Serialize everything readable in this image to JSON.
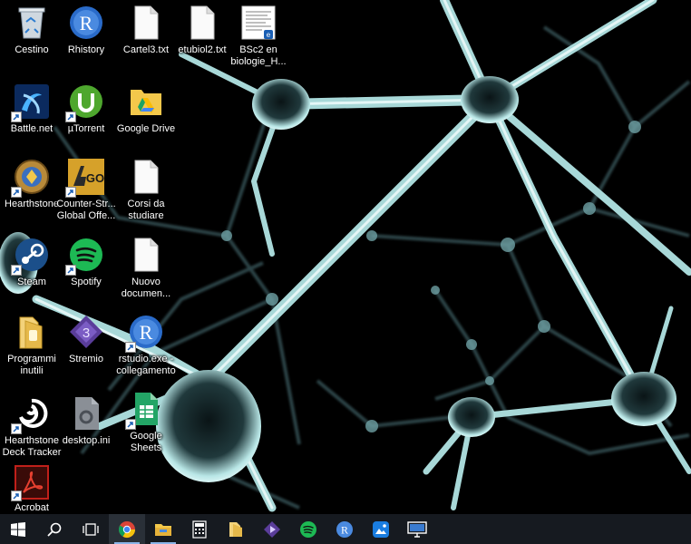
{
  "desktop": {
    "icons": [
      {
        "label": "Cestino",
        "icon": "recycle-bin-icon"
      },
      {
        "label": "Rhistory",
        "icon": "r-logo-icon"
      },
      {
        "label": "Cartel3.txt",
        "icon": "text-file-icon"
      },
      {
        "label": "etubiol2.txt",
        "icon": "text-file-icon"
      },
      {
        "label": "BSc2 en biologie_H...",
        "icon": "document-thumbnail-icon"
      },
      {
        "label": "Battle.net",
        "icon": "battle-net-icon"
      },
      {
        "label": "µTorrent",
        "icon": "utorrent-icon"
      },
      {
        "label": "Google Drive",
        "icon": "google-drive-folder-icon"
      },
      {
        "label": "Hearthstone",
        "icon": "hearthstone-icon"
      },
      {
        "label": "Counter-Str... Global Offe...",
        "icon": "csgo-icon",
        "badge": "GO"
      },
      {
        "label": "Corsi da studiare",
        "icon": "blank-file-icon"
      },
      {
        "label": "Steam",
        "icon": "steam-icon"
      },
      {
        "label": "Spotify",
        "icon": "spotify-icon"
      },
      {
        "label": "Nuovo documen...",
        "icon": "blank-file-icon"
      },
      {
        "label": "Programmi inutili",
        "icon": "folder-icon"
      },
      {
        "label": "Stremio",
        "icon": "stremio-icon",
        "badge": "3"
      },
      {
        "label": "rstudio.exe - collegamento",
        "icon": "r-logo-icon"
      },
      {
        "label": "Hearthstone Deck Tracker",
        "icon": "deck-tracker-icon"
      },
      {
        "label": "desktop.ini",
        "icon": "settings-file-icon"
      },
      {
        "label": "Google Sheets",
        "icon": "google-sheets-icon"
      },
      {
        "label": "Acrobat",
        "icon": "acrobat-icon"
      }
    ]
  },
  "taskbar": {
    "items": [
      {
        "name": "start-button",
        "icon": "windows-logo-icon"
      },
      {
        "name": "search-button",
        "icon": "search-icon"
      },
      {
        "name": "task-view-button",
        "icon": "task-view-icon"
      },
      {
        "name": "taskbar-chrome",
        "icon": "chrome-icon"
      },
      {
        "name": "taskbar-file-explorer",
        "icon": "file-explorer-icon"
      },
      {
        "name": "taskbar-calculator",
        "icon": "calculator-icon"
      },
      {
        "name": "taskbar-folder",
        "icon": "folder-icon"
      },
      {
        "name": "taskbar-stremio",
        "icon": "stremio-icon"
      },
      {
        "name": "taskbar-spotify",
        "icon": "spotify-icon"
      },
      {
        "name": "taskbar-rstudio",
        "icon": "r-logo-icon"
      },
      {
        "name": "taskbar-photos",
        "icon": "photos-icon"
      },
      {
        "name": "taskbar-remote-desktop",
        "icon": "remote-desktop-icon"
      }
    ]
  },
  "colors": {
    "taskbar_bg": "#161a20",
    "neuron": "#a8d8d8",
    "r_blue": "#2a6bc9",
    "spotify_green": "#1db954",
    "steam_blue": "#1b4f8a",
    "acrobat_red": "#c0201a",
    "sheets_green": "#23a566"
  }
}
